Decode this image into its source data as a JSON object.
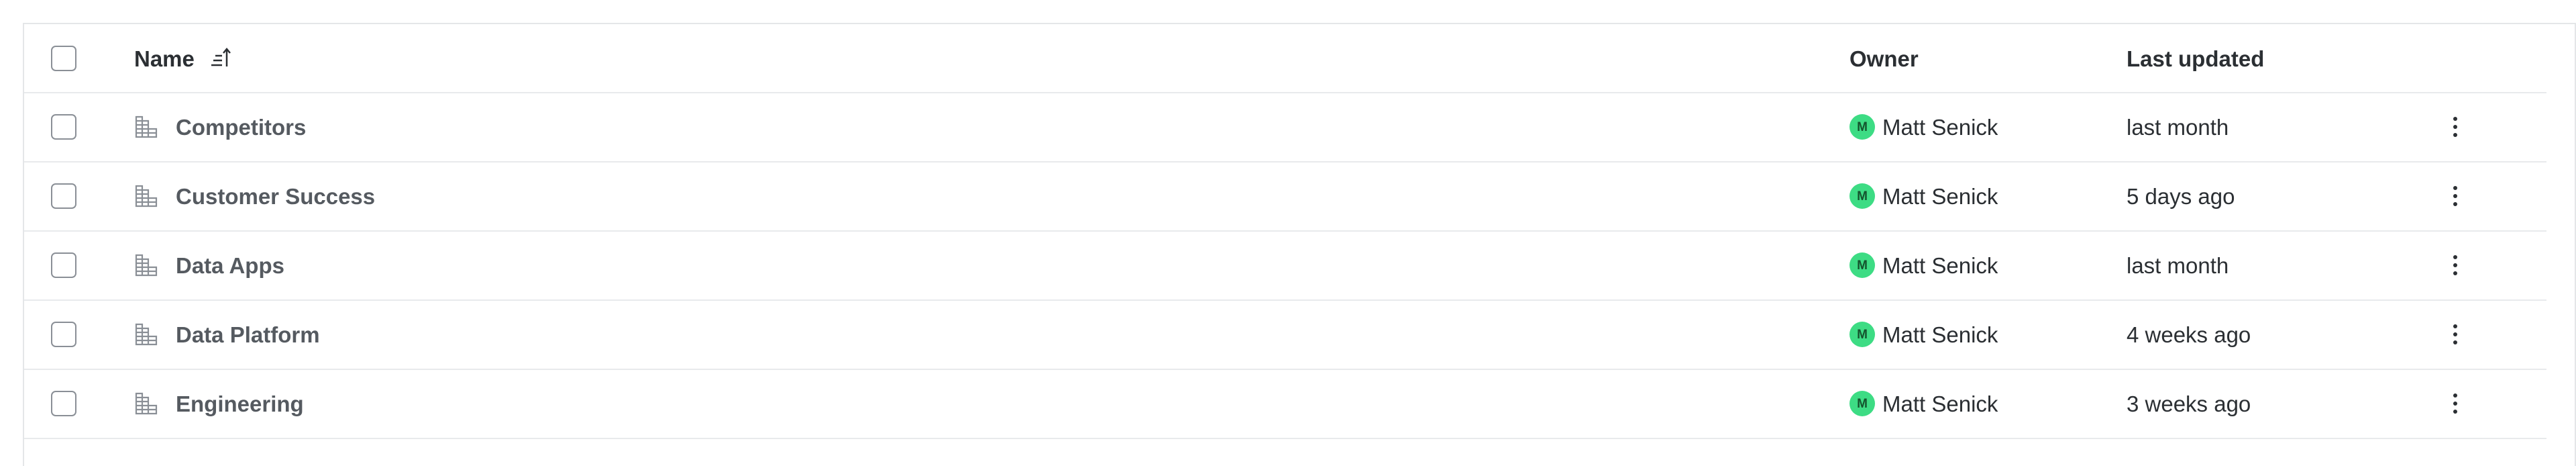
{
  "table": {
    "columns": {
      "select_all": "select-all-checkbox",
      "name": "Name",
      "owner": "Owner",
      "last_updated": "Last updated"
    },
    "sort_icon": "sort-ascending-icon",
    "rows": [
      {
        "name": "Competitors",
        "icon": "table-icon",
        "owner_initial": "M",
        "owner": "Matt Senick",
        "last_updated": "last month"
      },
      {
        "name": "Customer Success",
        "icon": "table-icon",
        "owner_initial": "M",
        "owner": "Matt Senick",
        "last_updated": "5 days ago"
      },
      {
        "name": "Data Apps",
        "icon": "table-icon",
        "owner_initial": "M",
        "owner": "Matt Senick",
        "last_updated": "last month"
      },
      {
        "name": "Data Platform",
        "icon": "table-icon",
        "owner_initial": "M",
        "owner": "Matt Senick",
        "last_updated": "4 weeks ago"
      },
      {
        "name": "Engineering",
        "icon": "table-icon",
        "owner_initial": "M",
        "owner": "Matt Senick",
        "last_updated": "3 weeks ago"
      }
    ],
    "row_menu_icon": "more-vertical-icon",
    "colors": {
      "avatar": "#3ddc84",
      "border": "#e4e6e8"
    }
  }
}
